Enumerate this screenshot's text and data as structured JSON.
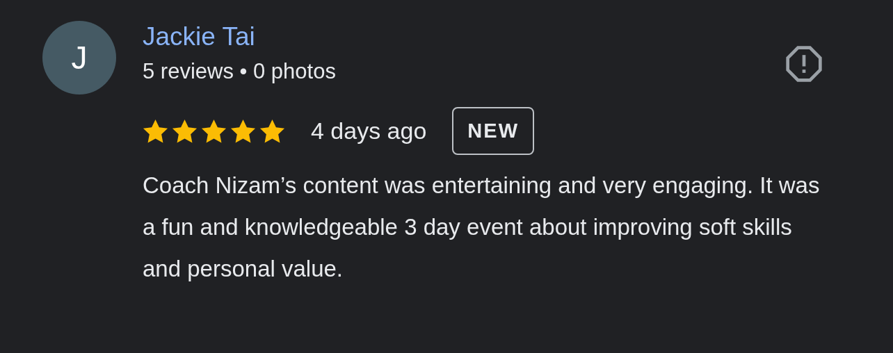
{
  "review": {
    "avatar_letter": "J",
    "author": "Jackie Tai",
    "meta": "5 reviews • 0 photos",
    "stars": 5,
    "time": "4 days ago",
    "badge": "NEW",
    "text": "Coach Nizam’s content was entertaining and very engaging. It was a fun and knowledgeable 3 day event about improving soft skills and personal value."
  }
}
